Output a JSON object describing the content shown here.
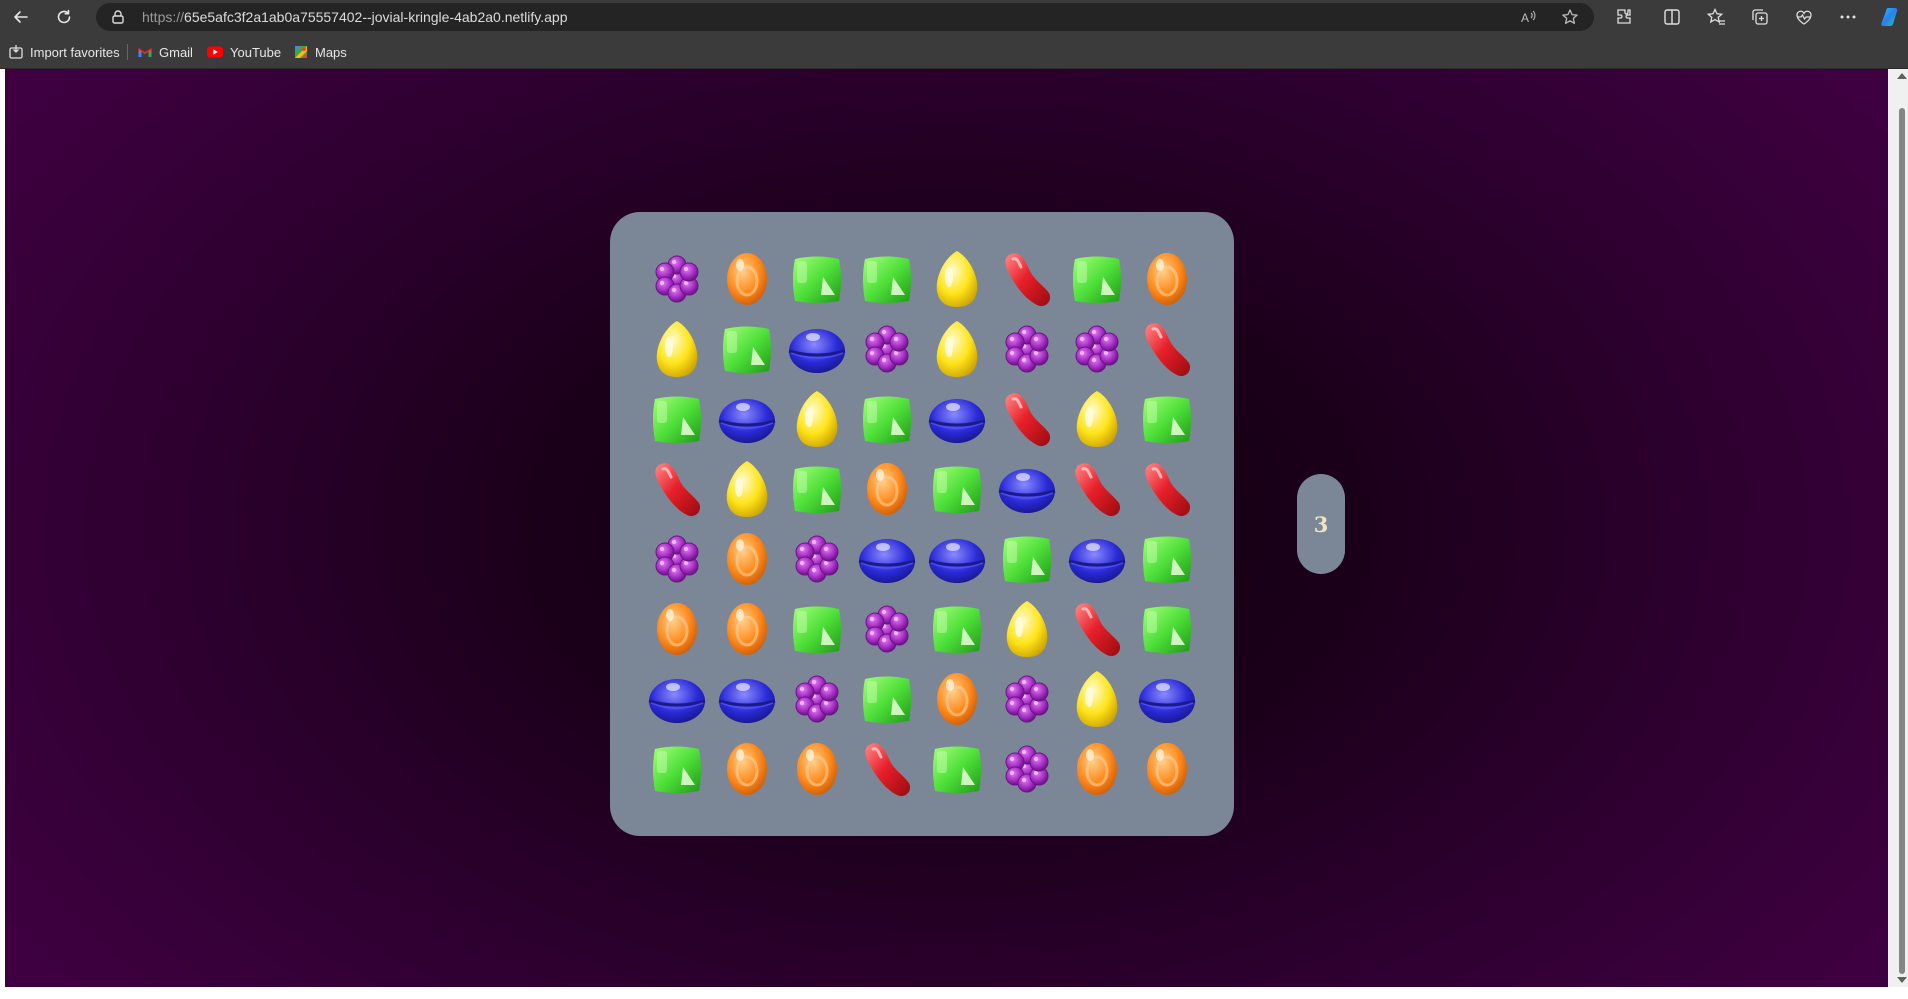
{
  "browser": {
    "url_scheme": "https://",
    "url_host": "65e5afc3f2a1ab0a75557402--jovial-kringle-4ab2a0.netlify.app",
    "bookmarks": [
      {
        "label": "Import favorites",
        "icon": "import-icon"
      },
      {
        "label": "Gmail",
        "icon": "gmail-icon"
      },
      {
        "label": "YouTube",
        "icon": "youtube-icon"
      },
      {
        "label": "Maps",
        "icon": "maps-icon"
      }
    ]
  },
  "game": {
    "score": "3",
    "candy_colors": {
      "purple": "#a12bc0",
      "orange": "#ff8a1e",
      "green": "#4fe03a",
      "yellow": "#ffe41a",
      "red": "#e8202a",
      "blue": "#2a2ad8"
    },
    "board": [
      [
        "purple",
        "orange",
        "green",
        "green",
        "yellow",
        "red",
        "green",
        "orange"
      ],
      [
        "yellow",
        "green",
        "blue",
        "purple",
        "yellow",
        "purple",
        "purple",
        "red"
      ],
      [
        "green",
        "blue",
        "yellow",
        "green",
        "blue",
        "red",
        "yellow",
        "green"
      ],
      [
        "red",
        "yellow",
        "green",
        "orange",
        "green",
        "blue",
        "red",
        "red"
      ],
      [
        "purple",
        "orange",
        "purple",
        "blue",
        "blue",
        "green",
        "blue",
        "green"
      ],
      [
        "orange",
        "orange",
        "green",
        "purple",
        "green",
        "yellow",
        "red",
        "green"
      ],
      [
        "blue",
        "blue",
        "purple",
        "green",
        "orange",
        "purple",
        "yellow",
        "blue"
      ],
      [
        "green",
        "orange",
        "orange",
        "red",
        "green",
        "purple",
        "orange",
        "orange"
      ]
    ]
  }
}
